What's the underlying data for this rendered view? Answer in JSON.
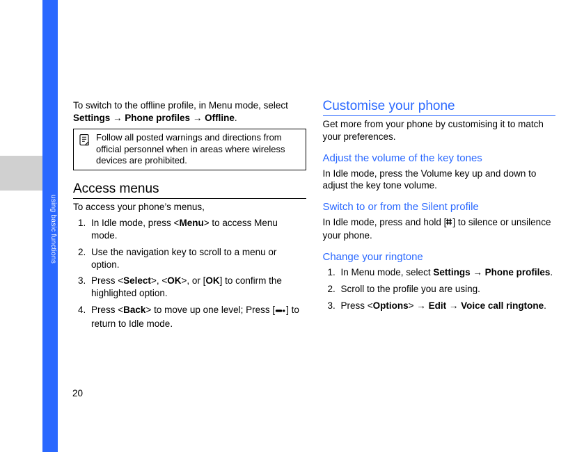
{
  "page_number": "20",
  "side_label": "using basic functions",
  "arrow": "→",
  "left": {
    "intro": {
      "pre": "To switch to the offline profile, in Menu mode, select ",
      "b1": "Settings",
      "b2": "Phone profiles",
      "b3": "Offline",
      "post": "."
    },
    "note": "Follow all posted warnings and directions from official personnel when in areas where wireless devices are prohibited.",
    "h_access": "Access menus",
    "access_lead": "To access your phone’s menus,",
    "steps": {
      "s1_pre": "In Idle mode, press <",
      "s1_b": "Menu",
      "s1_post": "> to access Menu mode.",
      "s2": "Use the navigation key to scroll to a menu or option.",
      "s3_pre": "Press <",
      "s3_b1": "Select",
      "s3_mid1": ">, <",
      "s3_b2": "OK",
      "s3_mid2": ">, or [",
      "s3_b3": "OK",
      "s3_post": "] to confirm the highlighted option.",
      "s4_pre": "Press <",
      "s4_b": "Back",
      "s4_mid": "> to move up one level; Press [",
      "s4_post": "] to return to Idle mode."
    }
  },
  "right": {
    "h_custom": "Customise your phone",
    "custom_lead": "Get more from your phone by customising it to match your preferences.",
    "h_vol": "Adjust the volume of the key tones",
    "vol_text": "In Idle mode, press the Volume key up and down to adjust the key tone volume.",
    "h_silent": "Switch to or from the Silent profile",
    "silent_pre": "In Idle mode, press and hold [",
    "silent_post": "] to silence or unsilence your phone.",
    "h_ring": "Change your ringtone",
    "ring": {
      "s1_pre": "In Menu mode, select ",
      "s1_b1": "Settings",
      "s1_b2": "Phone profiles",
      "s1_post": ".",
      "s2": "Scroll to the profile you are using.",
      "s3_pre": "Press <",
      "s3_b1": "Options",
      "s3_mid": "> ",
      "s3_b2": "Edit",
      "s3_b3": "Voice call ringtone",
      "s3_post": "."
    }
  }
}
